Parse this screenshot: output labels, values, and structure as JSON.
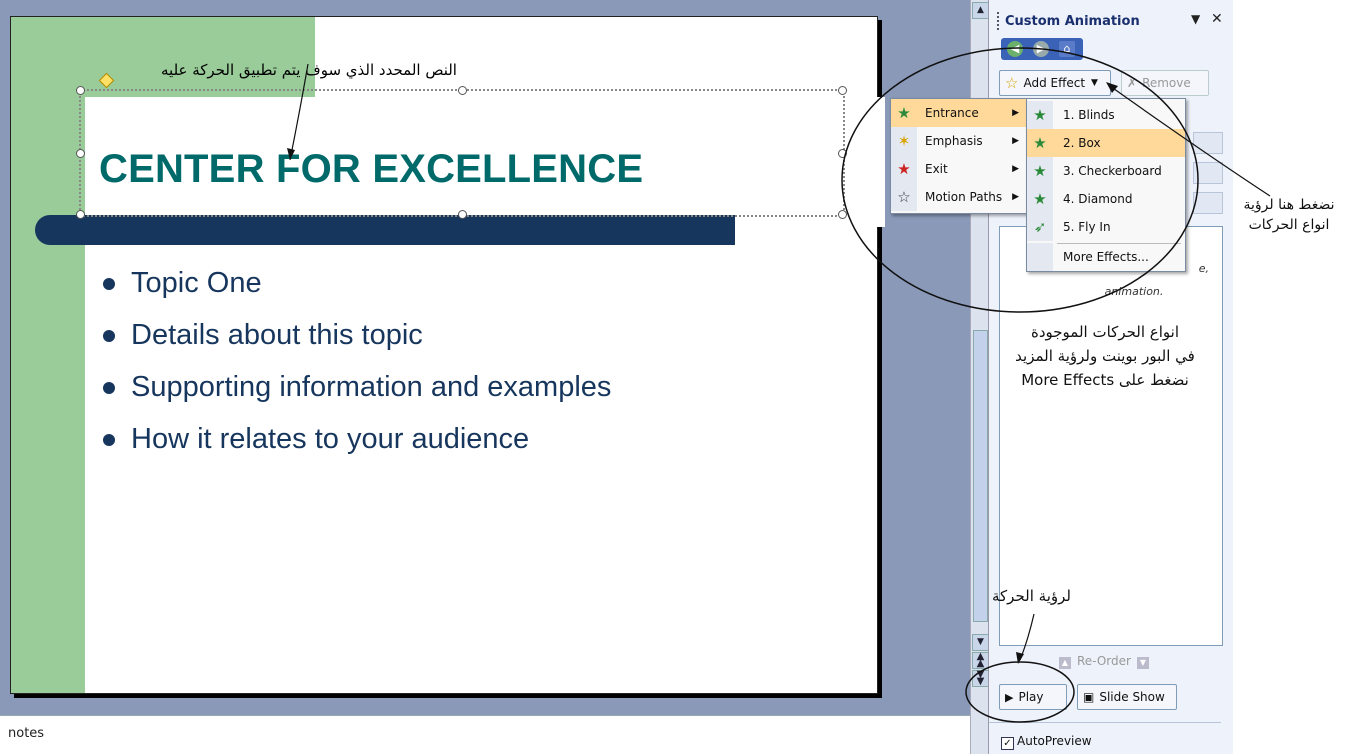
{
  "slide": {
    "title": "CENTER FOR EXCELLENCE",
    "bullets": [
      "Topic One",
      "Details about this topic",
      "Supporting information and examples",
      "How it relates to your audience"
    ],
    "annotation": "النص المحدد الذي سوف يتم تطبيق الحركة عليه"
  },
  "notes": {
    "label": "notes"
  },
  "task_pane": {
    "title": "Custom Animation",
    "add_effect": "Add Effect",
    "remove": "Remove",
    "list_hint_1": "e,",
    "list_hint_2": "animation.",
    "reorder": "Re-Order",
    "play": "Play",
    "slide_show": "Slide Show",
    "autopreview": "AutoPreview",
    "annotation_lines": [
      "انواع الحركات الموجودة",
      "في البور بوينت ولرؤية المزيد",
      "نضغط على More Effects"
    ]
  },
  "menu": {
    "items": [
      "Entrance",
      "Emphasis",
      "Exit",
      "Motion Paths"
    ]
  },
  "submenu": {
    "items": [
      "1. Blinds",
      "2. Box",
      "3. Checkerboard",
      "4. Diamond",
      "5. Fly In"
    ],
    "more": "More Effects..."
  },
  "annotations": {
    "right_lines": [
      "نضغط هنا لرؤية",
      "انواع الحركات"
    ],
    "play": "لرؤية الحركة"
  },
  "colors": {
    "title": "#006a6a",
    "navy": "#17365d",
    "green": "#99cc99",
    "menu_highlight": "#ffd99a"
  }
}
